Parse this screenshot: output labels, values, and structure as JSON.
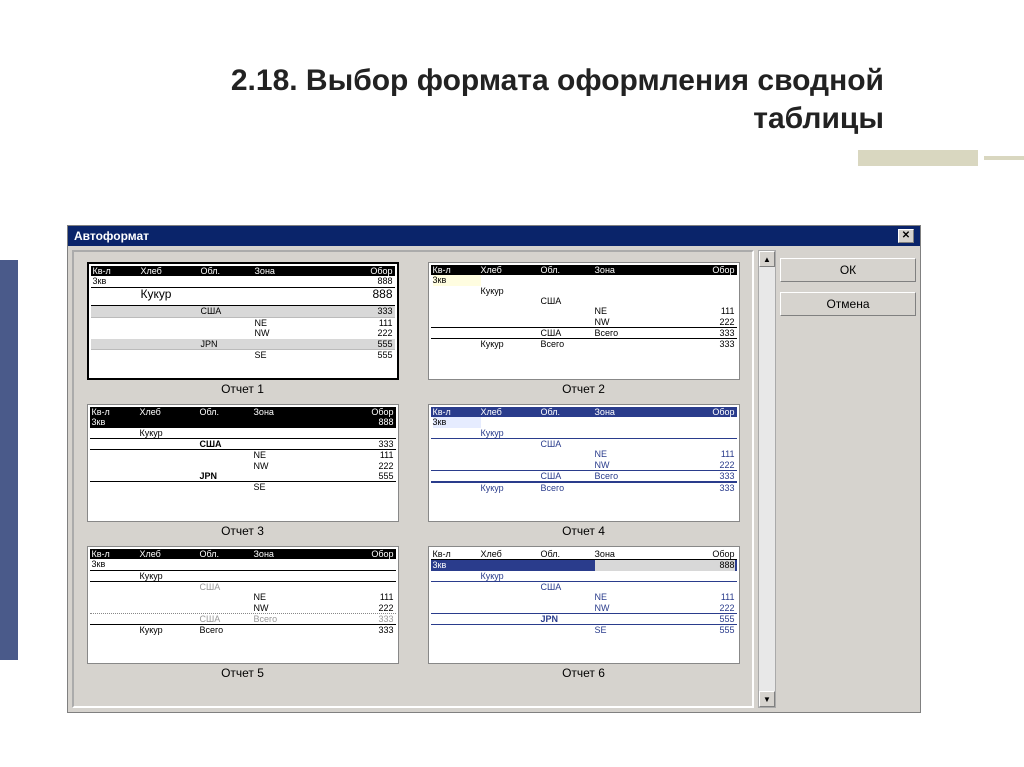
{
  "slide": {
    "title": "2.18. Выбор формата оформления сводной таблицы"
  },
  "dialog": {
    "title": "Автоформат",
    "buttons": {
      "ok": "ОК",
      "cancel": "Отмена"
    },
    "close_symbol": "✕",
    "scroll_up": "▲",
    "scroll_down": "▼"
  },
  "columns": {
    "c1": "Кв-л",
    "c2": "Хлеб",
    "c3": "Обл.",
    "c4": "Зона",
    "c5": "Обор"
  },
  "common": {
    "row_3kv": "3кв",
    "kukur": "Кукур",
    "usa": "США",
    "jpn": "JPN",
    "ne": "NE",
    "nw": "NW",
    "se": "SE",
    "total": "Всего",
    "v888": "888",
    "v333": "333",
    "v111": "111",
    "v222": "222",
    "v555": "555"
  },
  "captions": {
    "r1": "Отчет 1",
    "r2": "Отчет 2",
    "r3": "Отчет 3",
    "r4": "Отчет 4",
    "r5": "Отчет 5",
    "r6": "Отчет 6"
  }
}
